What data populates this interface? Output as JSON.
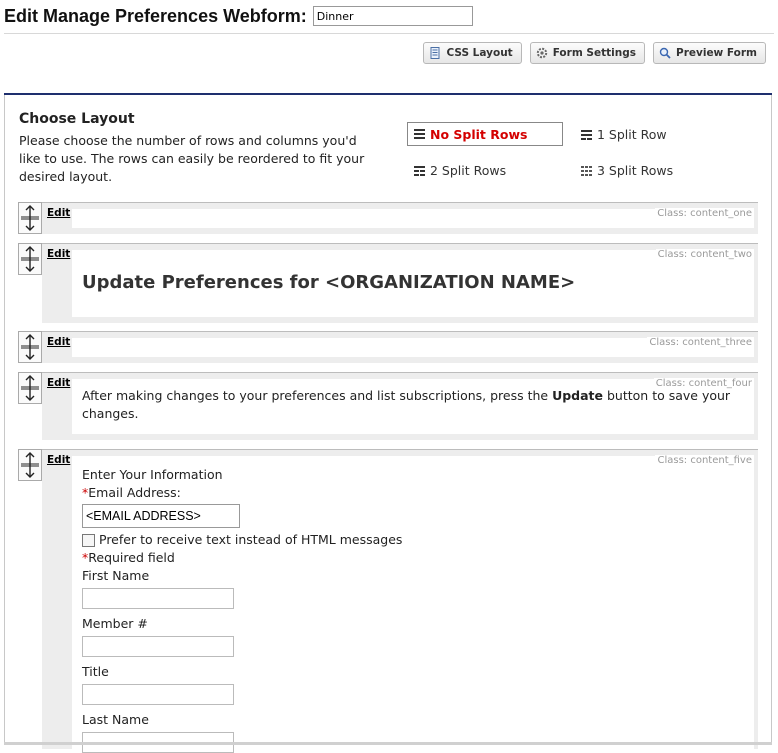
{
  "header": {
    "title": "Edit Manage Preferences Webform:",
    "form_name_value": "Dinner"
  },
  "toolbar": {
    "css_layout": "CSS Layout",
    "form_settings": "Form Settings",
    "preview_form": "Preview Form"
  },
  "choose_layout": {
    "title": "Choose Layout",
    "description": "Please choose the number of rows and columns you'd like to use. The rows can easily be reordered to fit your desired layout.",
    "options": [
      {
        "label": "No Split Rows",
        "selected": true
      },
      {
        "label": "1 Split Row",
        "selected": false
      },
      {
        "label": "2 Split Rows",
        "selected": false
      },
      {
        "label": "3 Split Rows",
        "selected": false
      }
    ],
    "selected_color": "#d40000"
  },
  "rows": [
    {
      "edit": "Edit",
      "class_label": "Class: content_one"
    },
    {
      "edit": "Edit",
      "class_label": "Class: content_two",
      "heading": "Update Preferences for <ORGANIZATION NAME>"
    },
    {
      "edit": "Edit",
      "class_label": "Class: content_three"
    },
    {
      "edit": "Edit",
      "class_label": "Class: content_four",
      "text_before": "After making changes to your preferences and list subscriptions, press the ",
      "text_bold": "Update",
      "text_after": " button to save your changes."
    },
    {
      "edit": "Edit",
      "class_label": "Class: content_five"
    }
  ],
  "form": {
    "section_title": "Enter Your Information",
    "required_mark": "*",
    "email_label": "Email Address:",
    "email_value": "<EMAIL ADDRESS>",
    "text_pref_label": "Prefer to receive text instead of HTML messages",
    "required_note": "Required field",
    "fields": [
      {
        "label": "First Name"
      },
      {
        "label": "Member #"
      },
      {
        "label": "Title"
      },
      {
        "label": "Last Name"
      }
    ]
  },
  "colors": {
    "accent_bar": "#1e2f6e",
    "required": "#cc0000"
  }
}
